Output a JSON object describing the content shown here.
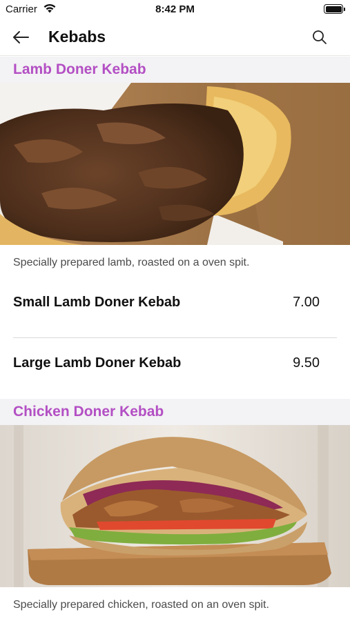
{
  "status_bar": {
    "carrier": "Carrier",
    "time": "8:42 PM",
    "battery_level": 1.0
  },
  "nav": {
    "title": "Kebabs",
    "back_icon": "arrow-left-icon",
    "search_icon": "search-icon"
  },
  "colors": {
    "accent": "#b34fc4",
    "section_bg": "#f3f2f4"
  },
  "sections": [
    {
      "title": "Lamb Doner Kebab",
      "image": "lamb-doner-kebab-photo",
      "description": "Specially prepared lamb, roasted on a oven spit.",
      "items": [
        {
          "name": "Small Lamb Doner Kebab",
          "price": "7.00"
        },
        {
          "name": "Large Lamb Doner Kebab",
          "price": "9.50"
        }
      ]
    },
    {
      "title": "Chicken Doner Kebab",
      "image": "chicken-doner-kebab-photo",
      "description": "Specially prepared chicken, roasted on an oven spit."
    }
  ]
}
